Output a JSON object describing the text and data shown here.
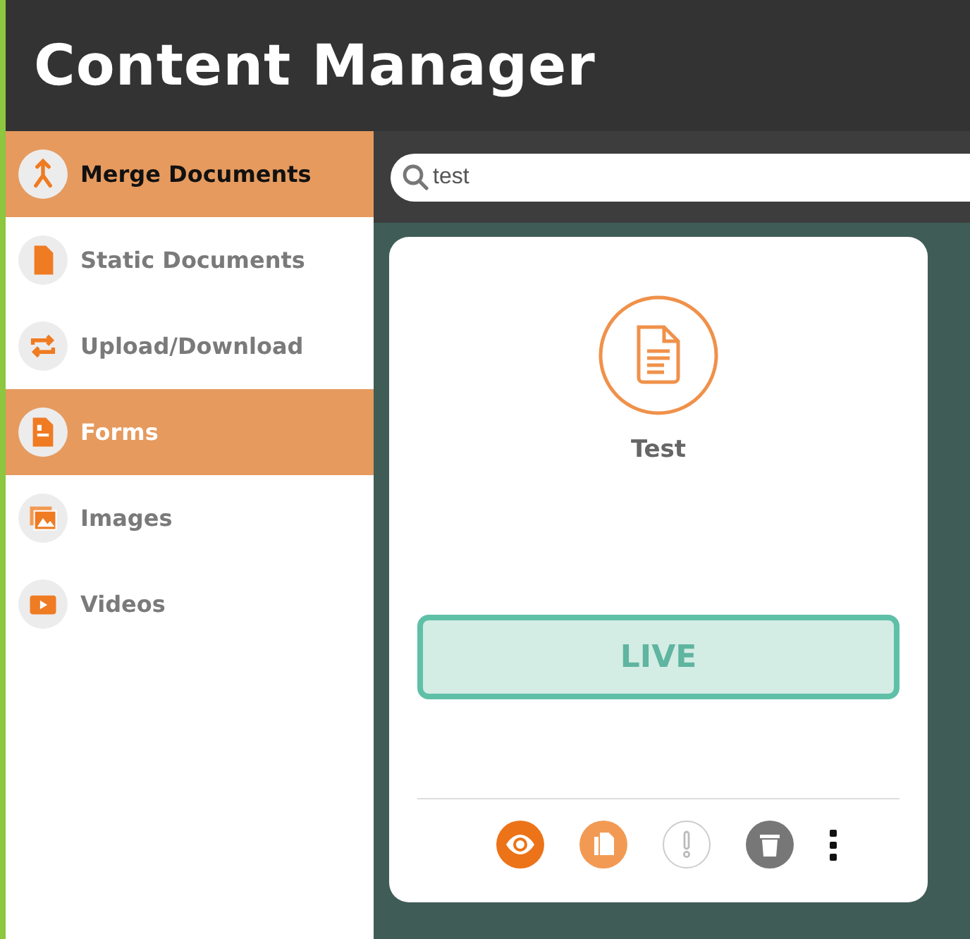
{
  "header": {
    "title": "Content Manager"
  },
  "sidebar": {
    "items": [
      {
        "label": "Merge Documents",
        "kind": "merge",
        "selected": false,
        "hovered": true
      },
      {
        "label": "Static Documents",
        "kind": "static",
        "selected": false,
        "hovered": false
      },
      {
        "label": "Upload/Download",
        "kind": "transfer",
        "selected": false,
        "hovered": false
      },
      {
        "label": "Forms",
        "kind": "forms",
        "selected": true,
        "hovered": false
      },
      {
        "label": "Images",
        "kind": "images",
        "selected": false,
        "hovered": false
      },
      {
        "label": "Videos",
        "kind": "videos",
        "selected": false,
        "hovered": false
      }
    ]
  },
  "search": {
    "value": "test"
  },
  "cards": [
    {
      "title": "Test",
      "status": "LIVE",
      "actions": [
        {
          "kind": "view"
        },
        {
          "kind": "copy"
        },
        {
          "kind": "alert"
        },
        {
          "kind": "delete"
        },
        {
          "kind": "more"
        }
      ]
    }
  ]
}
